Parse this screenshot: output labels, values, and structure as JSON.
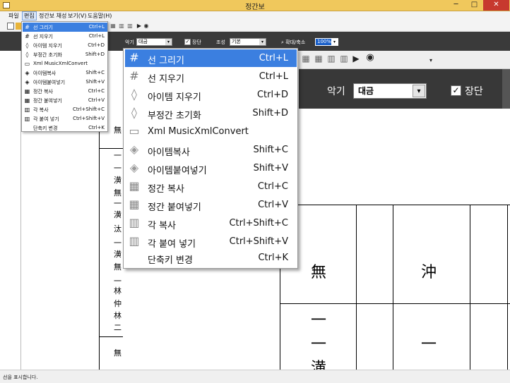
{
  "app": {
    "title": "정간보",
    "status": "선을 표시합니다."
  },
  "window_buttons": {
    "minimize": "─",
    "maximize": "□",
    "close": "✕"
  },
  "menubar": {
    "items": [
      "파일",
      "편집",
      "정간보 채성",
      "보기(V)",
      "도움말(H)"
    ],
    "active_index": 1
  },
  "toolbar": {
    "instrument_label": "악기",
    "instrument_value": "대금",
    "jangdan_label": "장단",
    "jangdan_checked": true,
    "mode_label": "조성",
    "mode_value": "기본",
    "zoom_label": "확대/축소",
    "zoom_value": "100%"
  },
  "bg_toolbar": {
    "instrument_label": "악기",
    "instrument_value": "대금",
    "jangdan_label": "장단"
  },
  "edit_menu_small": [
    {
      "label": "선 그리기",
      "shortcut": "Ctrl+L",
      "icon": "hash-icon",
      "highlighted": true
    },
    {
      "label": "선 지우기",
      "shortcut": "Ctrl+L",
      "icon": "hash-icon"
    },
    {
      "label": "아이템 지우기",
      "shortcut": "Ctrl+D",
      "icon": "eraser-icon"
    },
    {
      "label": "부정간 초기화",
      "shortcut": "Shift+D",
      "icon": "eraser-icon"
    },
    {
      "label": "Xml MusicXmlConvert",
      "shortcut": "",
      "icon": "xml-icon"
    },
    {
      "label": "아이템복사",
      "shortcut": "Shift+C",
      "icon": "cube-icon"
    },
    {
      "label": "아이템붙여넣기",
      "shortcut": "Shift+V",
      "icon": "cube-paste-icon"
    },
    {
      "label": "정간 복사",
      "shortcut": "Ctrl+C",
      "icon": "cells-icon"
    },
    {
      "label": "정간 붙여넣기",
      "shortcut": "Ctrl+V",
      "icon": "cells-paste-icon"
    },
    {
      "label": "각 복사",
      "shortcut": "Ctrl+Shift+C",
      "icon": "bars-icon"
    },
    {
      "label": "각 붙여 넣기",
      "shortcut": "Ctrl+Shift+V",
      "icon": "bars-paste-icon"
    },
    {
      "label": "단축키 변경",
      "shortcut": "Ctrl+K",
      "icon": ""
    }
  ],
  "edit_menu_large": [
    {
      "label": "선 그리기",
      "shortcut": "Ctrl+L",
      "icon": "hash-icon",
      "highlighted": true
    },
    {
      "label": "선 지우기",
      "shortcut": "Ctrl+L",
      "icon": "hash-icon"
    },
    {
      "label": "아이템 지우기",
      "shortcut": "Ctrl+D",
      "icon": "eraser-icon"
    },
    {
      "label": "부정간 초기화",
      "shortcut": "Shift+D",
      "icon": "eraser-icon"
    },
    {
      "label": "Xml MusicXmlConvert",
      "shortcut": "",
      "icon": "xml-icon"
    },
    {
      "label": "아이템복사",
      "shortcut": "Shift+C",
      "icon": "cube-icon"
    },
    {
      "label": "아이템붙여넣기",
      "shortcut": "Shift+V",
      "icon": "cube-paste-icon"
    },
    {
      "label": "정간 복사",
      "shortcut": "Ctrl+C",
      "icon": "cells-icon"
    },
    {
      "label": "정간 붙여넣기",
      "shortcut": "Ctrl+V",
      "icon": "cells-paste-icon"
    },
    {
      "label": "각 복사",
      "shortcut": "Ctrl+Shift+C",
      "icon": "bars-icon"
    },
    {
      "label": "각 붙여 넣기",
      "shortcut": "Ctrl+Shift+V",
      "icon": "bars-paste-icon"
    },
    {
      "label": "단축키 변경",
      "shortcut": "Ctrl+K",
      "icon": ""
    }
  ],
  "score": {
    "left_column": [
      "無",
      "一",
      "一",
      "潢",
      "無",
      "一",
      "潢",
      "汰",
      "一",
      "潢",
      "無",
      "一",
      "林",
      "仲",
      "林",
      "二",
      "無"
    ],
    "right_cells": {
      "cell1_top": "無",
      "cell2_top": "沖",
      "cell1_mid1": "一",
      "cell1_mid2": "一",
      "cell1_bottom": "潢",
      "cell2_mid": "一"
    }
  }
}
